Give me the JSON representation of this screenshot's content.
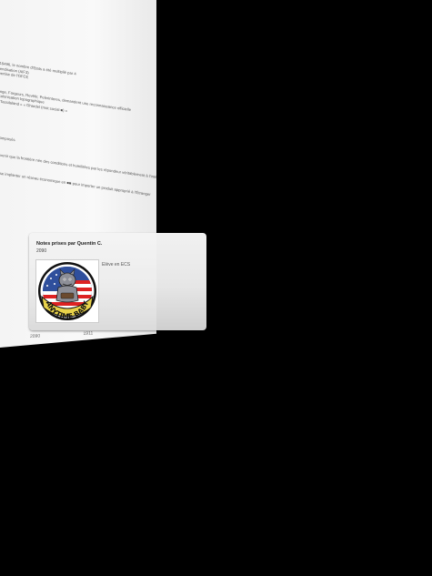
{
  "document": {
    "lines": [
      "fin 19496, le nombre d'Etats a été multiplié par 4",
      "rintendisation (AIF3)",
      "expertise de l'OFCE",
      "",
      "mange, Forgeurs, Revêtir, Pelerinteres, demandent une reconnaissance officielle",
      "décolonisation topographique",
      "* « Tassilaland » « Ghardel (mot social ■) »",
      "",
      "",
      "e composés",
      "",
      "prévenir que la frontière née des conditions et humilitées par les répondeur véritablement à l'intérieur d'un peuple",
      "",
      "de se implanter un réseau économique en ■■ pour importer un produit approprié à l'Étranger"
    ],
    "footer": [
      "2090",
      "1911"
    ]
  },
  "note_card": {
    "title": "Notes prises par Quentin C.",
    "year": "2090",
    "role": "Elève en ECS",
    "badge_text": "ANYTIME BABY"
  }
}
